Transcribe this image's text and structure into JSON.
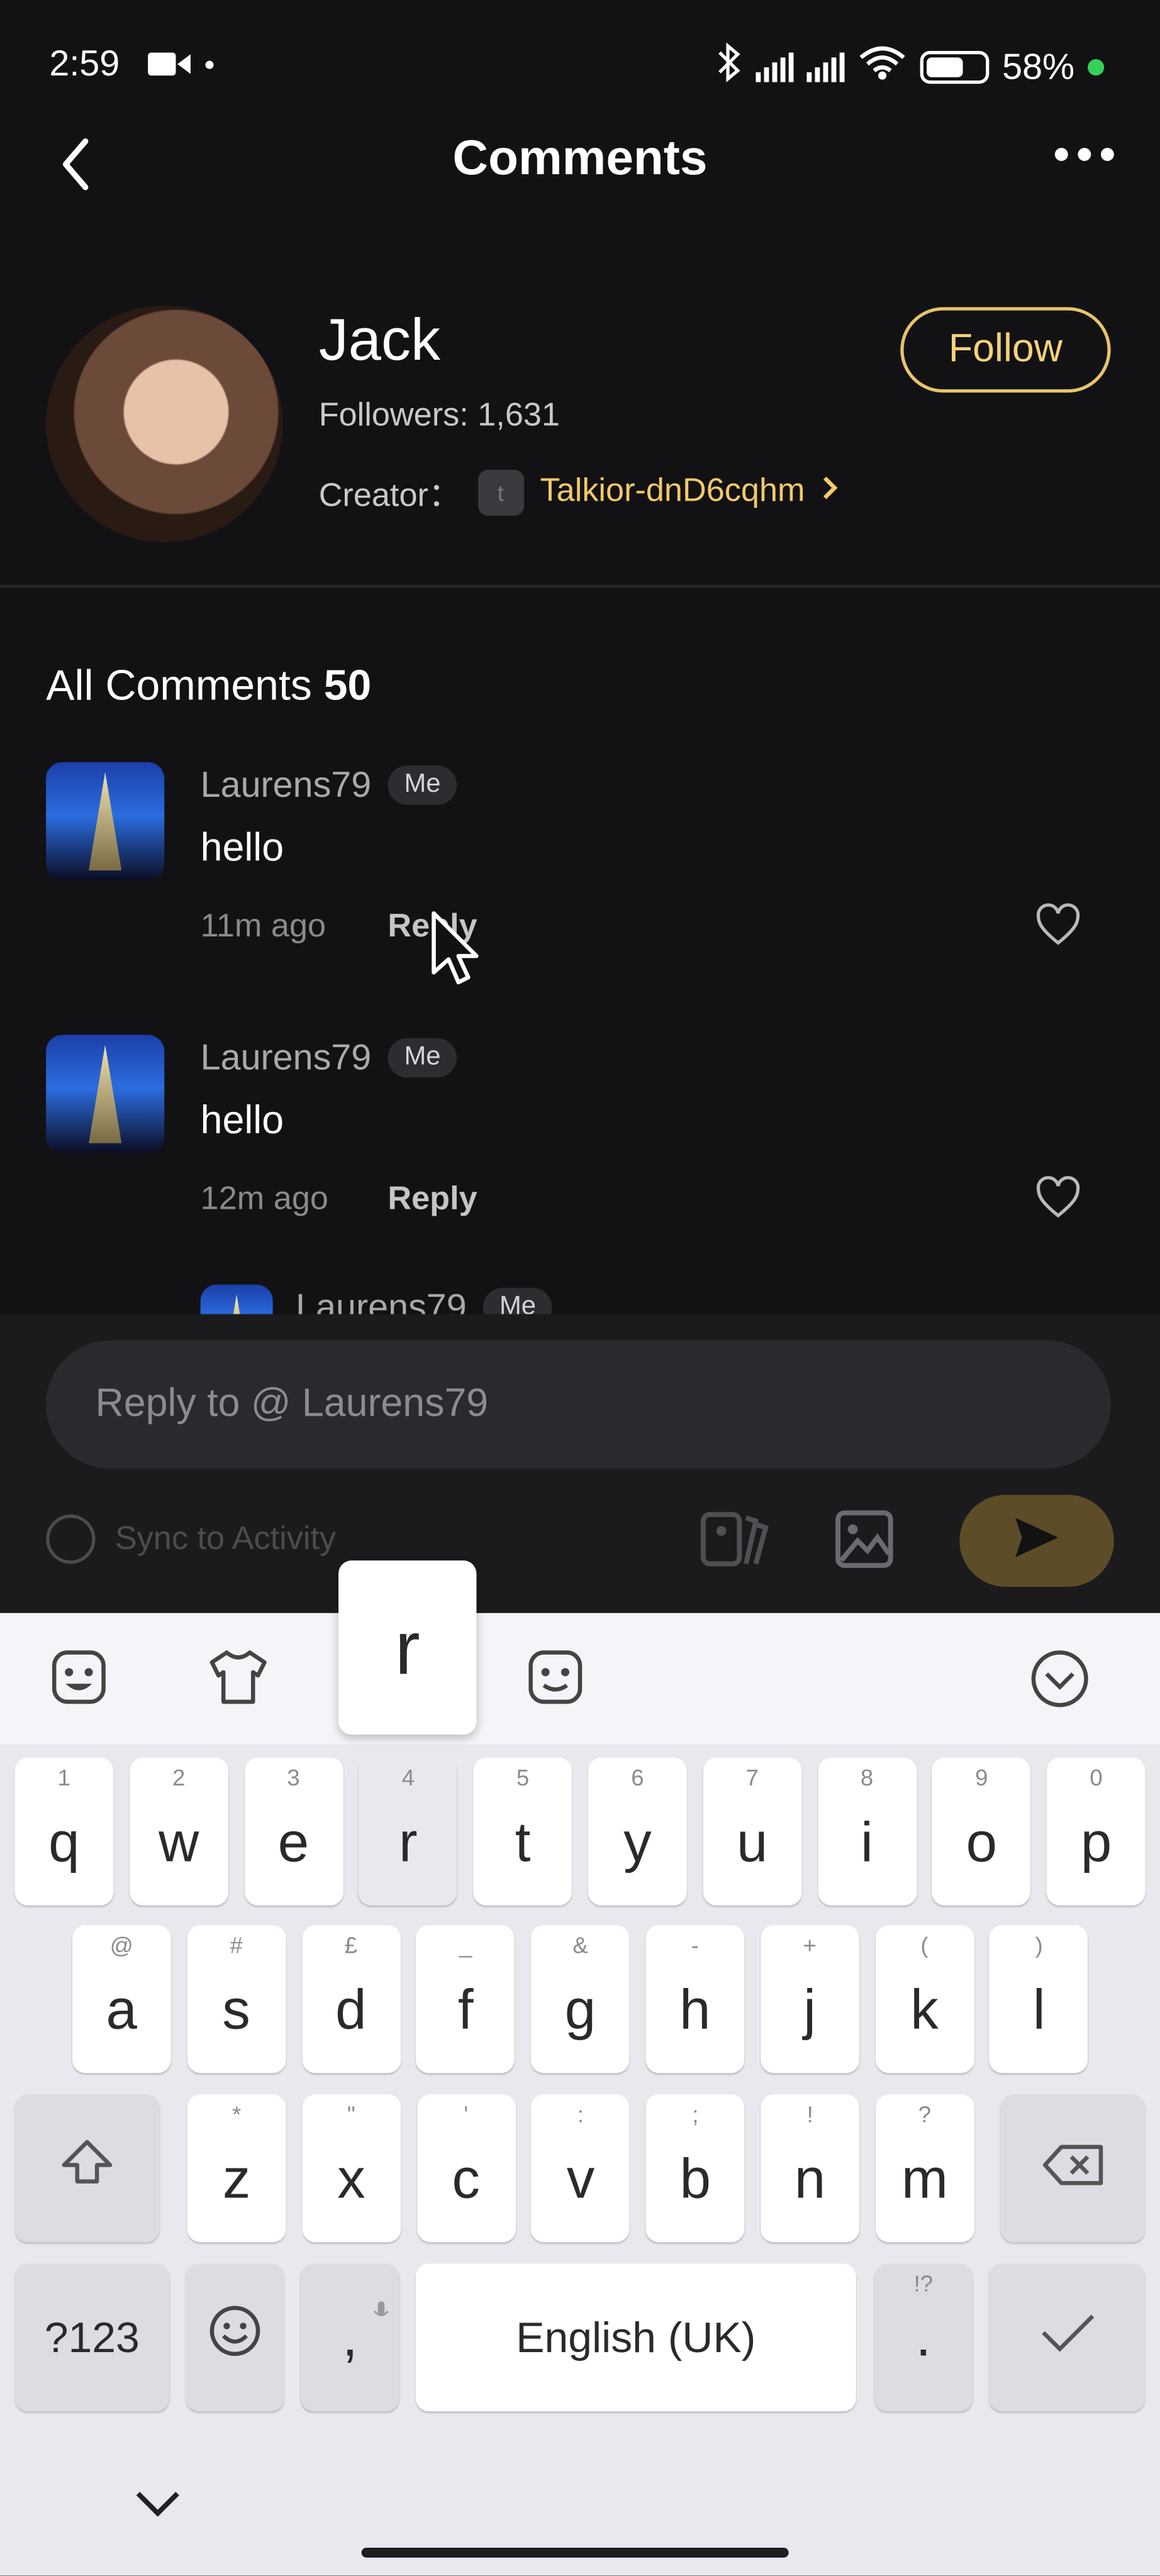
{
  "status_bar": {
    "time": "2:59",
    "battery": "58%"
  },
  "header": {
    "title": "Comments"
  },
  "profile": {
    "name": "Jack",
    "followers": "Followers: 1,631",
    "creator_label": "Creator：",
    "creator_name": "Talkior-dnD6cqhm",
    "follow_label": "Follow"
  },
  "comments_section": {
    "heading": "All Comments",
    "count": "50",
    "items": [
      {
        "user": "Laurens79",
        "badge": "Me",
        "text": "hello",
        "time": "11m ago",
        "reply_label": "Reply"
      },
      {
        "user": "Laurens79",
        "badge": "Me",
        "text": "hello",
        "time": "12m ago",
        "reply_label": "Reply"
      },
      {
        "user": "Laurens79",
        "badge": "Me"
      }
    ]
  },
  "composer": {
    "placeholder": "Reply to @ Laurens79",
    "sync_label": "Sync to Activity"
  },
  "keyboard": {
    "popup_key": "r",
    "row1": [
      {
        "key": "q",
        "hint": "1"
      },
      {
        "key": "w",
        "hint": "2"
      },
      {
        "key": "e",
        "hint": "3"
      },
      {
        "key": "r",
        "hint": "4"
      },
      {
        "key": "t",
        "hint": "5"
      },
      {
        "key": "y",
        "hint": "6"
      },
      {
        "key": "u",
        "hint": "7"
      },
      {
        "key": "i",
        "hint": "8"
      },
      {
        "key": "o",
        "hint": "9"
      },
      {
        "key": "p",
        "hint": "0"
      }
    ],
    "row2": [
      {
        "key": "a",
        "hint": "@"
      },
      {
        "key": "s",
        "hint": "#"
      },
      {
        "key": "d",
        "hint": "£"
      },
      {
        "key": "f",
        "hint": "_"
      },
      {
        "key": "g",
        "hint": "&"
      },
      {
        "key": "h",
        "hint": "-"
      },
      {
        "key": "j",
        "hint": "+"
      },
      {
        "key": "k",
        "hint": "("
      },
      {
        "key": "l",
        "hint": ")"
      }
    ],
    "row3": [
      {
        "key": "z",
        "hint": "*"
      },
      {
        "key": "x",
        "hint": "\""
      },
      {
        "key": "c",
        "hint": "'"
      },
      {
        "key": "v",
        "hint": ":"
      },
      {
        "key": "b",
        "hint": ";"
      },
      {
        "key": "n",
        "hint": "!"
      },
      {
        "key": "m",
        "hint": "?"
      }
    ],
    "symbols_label": "?123",
    "comma": ",",
    "space_label": "English (UK)",
    "period": ".",
    "period_hint": "!?"
  }
}
